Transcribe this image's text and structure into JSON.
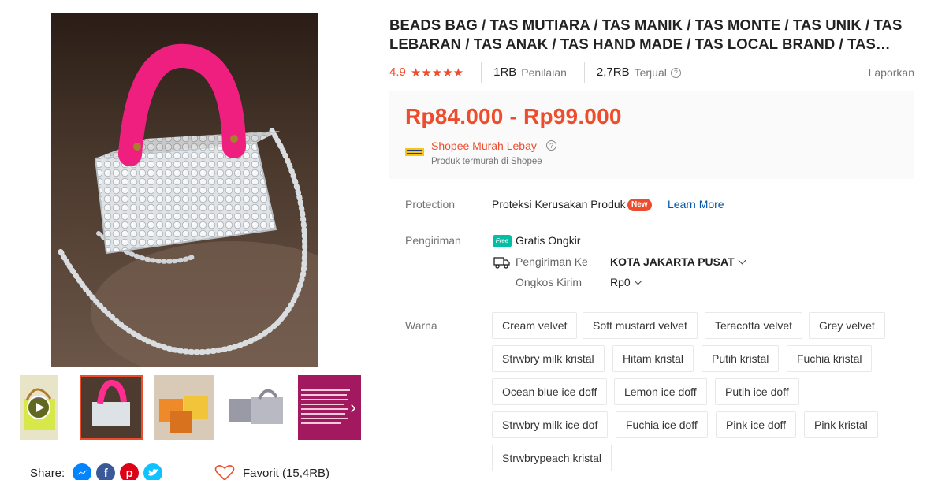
{
  "product": {
    "title": "BEADS BAG / TAS MUTIARA / TAS MANIK / TAS MONTE / TAS UNIK / TAS LEBARAN / TAS ANAK / TAS HAND MADE / TAS LOCAL BRAND / TAS…",
    "rating": "4.9",
    "stars": "★★★★★",
    "reviews_count": "1RB",
    "reviews_label": "Penilaian",
    "sold_count": "2,7RB",
    "sold_label": "Terjual",
    "report_label": "Laporkan"
  },
  "price": {
    "range": "Rp84.000 - Rp99.000",
    "shop_badge": "Shopee Murah Lebay",
    "shop_badge_sub": "Produk termurah di Shopee"
  },
  "protection": {
    "label": "Protection",
    "text": "Proteksi Kerusakan Produk",
    "badge": "New",
    "link": "Learn More"
  },
  "shipping": {
    "label": "Pengiriman",
    "free_icon_text": "Free",
    "free_text": "Gratis Ongkir",
    "to_label": "Pengiriman Ke",
    "to_value": "KOTA JAKARTA PUSAT",
    "cost_label": "Ongkos Kirim",
    "cost_value": "Rp0"
  },
  "variations": {
    "label": "Warna",
    "options": [
      "Cream velvet",
      "Soft mustard velvet",
      "Teracotta velvet",
      "Grey velvet",
      "Strwbry milk kristal",
      "Hitam kristal",
      "Putih kristal",
      "Fuchia kristal",
      "Ocean blue ice doff",
      "Lemon ice doff",
      "Putih ice doff",
      "Strwbry milk ice dof",
      "Fuchia ice doff",
      "Pink ice doff",
      "Pink kristal",
      "Strwbrypeach kristal"
    ]
  },
  "share": {
    "label": "Share:",
    "icons": [
      "messenger-icon",
      "facebook-icon",
      "pinterest-icon",
      "twitter-icon"
    ]
  },
  "favorite": {
    "label": "Favorit (15,4RB)"
  },
  "colors": {
    "accent": "#ee4d2d",
    "link": "#0055aa",
    "free_shipping": "#00bfa5"
  }
}
